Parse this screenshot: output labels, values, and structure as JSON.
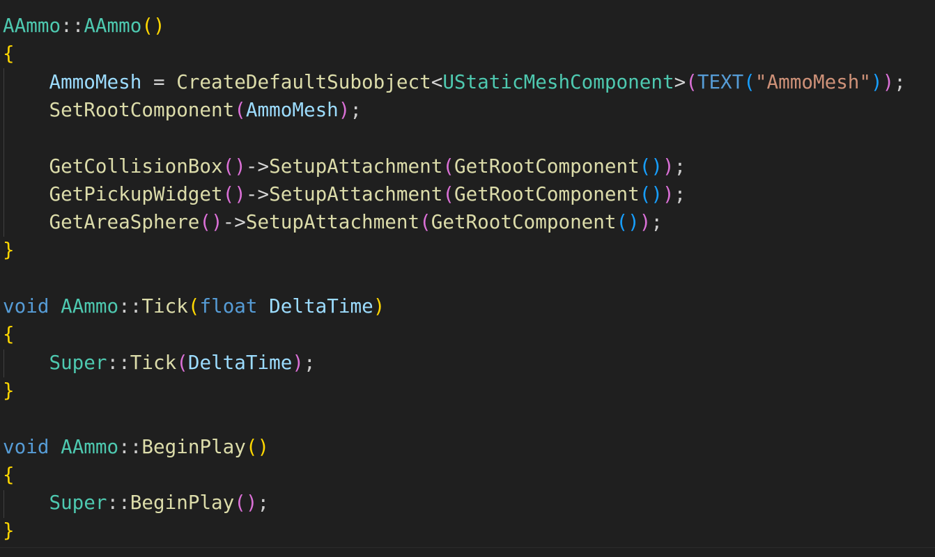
{
  "lines": [
    [
      [
        "type",
        "AAmmo"
      ],
      [
        "punct",
        "::"
      ],
      [
        "type",
        "AAmmo"
      ],
      [
        "b1",
        "()"
      ]
    ],
    [
      [
        "b1",
        "{"
      ]
    ],
    [
      [
        "ws",
        "    "
      ],
      [
        "var",
        "AmmoMesh"
      ],
      [
        "op",
        " = "
      ],
      [
        "fn",
        "CreateDefaultSubobject"
      ],
      [
        "op",
        "<"
      ],
      [
        "type",
        "UStaticMeshComponent"
      ],
      [
        "op",
        ">"
      ],
      [
        "b2",
        "("
      ],
      [
        "kw",
        "TEXT"
      ],
      [
        "b3",
        "("
      ],
      [
        "str",
        "\"AmmoMesh\""
      ],
      [
        "b3",
        ")"
      ],
      [
        "b2",
        ")"
      ],
      [
        "punct",
        ";"
      ]
    ],
    [
      [
        "ws",
        "    "
      ],
      [
        "fn",
        "SetRootComponent"
      ],
      [
        "b2",
        "("
      ],
      [
        "var",
        "AmmoMesh"
      ],
      [
        "b2",
        ")"
      ],
      [
        "punct",
        ";"
      ]
    ],
    [],
    [
      [
        "ws",
        "    "
      ],
      [
        "fn",
        "GetCollisionBox"
      ],
      [
        "b2",
        "()"
      ],
      [
        "op",
        "->"
      ],
      [
        "fn",
        "SetupAttachment"
      ],
      [
        "b2",
        "("
      ],
      [
        "fn",
        "GetRootComponent"
      ],
      [
        "b3",
        "()"
      ],
      [
        "b2",
        ")"
      ],
      [
        "punct",
        ";"
      ]
    ],
    [
      [
        "ws",
        "    "
      ],
      [
        "fn",
        "GetPickupWidget"
      ],
      [
        "b2",
        "()"
      ],
      [
        "op",
        "->"
      ],
      [
        "fn",
        "SetupAttachment"
      ],
      [
        "b2",
        "("
      ],
      [
        "fn",
        "GetRootComponent"
      ],
      [
        "b3",
        "()"
      ],
      [
        "b2",
        ")"
      ],
      [
        "punct",
        ";"
      ]
    ],
    [
      [
        "ws",
        "    "
      ],
      [
        "fn",
        "GetAreaSphere"
      ],
      [
        "b2",
        "()"
      ],
      [
        "op",
        "->"
      ],
      [
        "fn",
        "SetupAttachment"
      ],
      [
        "b2",
        "("
      ],
      [
        "fn",
        "GetRootComponent"
      ],
      [
        "b3",
        "()"
      ],
      [
        "b2",
        ")"
      ],
      [
        "punct",
        ";"
      ]
    ],
    [
      [
        "b1",
        "}"
      ]
    ],
    [],
    [
      [
        "kw",
        "void"
      ],
      [
        "op",
        " "
      ],
      [
        "type",
        "AAmmo"
      ],
      [
        "punct",
        "::"
      ],
      [
        "fn",
        "Tick"
      ],
      [
        "b1",
        "("
      ],
      [
        "kw",
        "float"
      ],
      [
        "op",
        " "
      ],
      [
        "var",
        "DeltaTime"
      ],
      [
        "b1",
        ")"
      ]
    ],
    [
      [
        "b1",
        "{"
      ]
    ],
    [
      [
        "ws",
        "    "
      ],
      [
        "type",
        "Super"
      ],
      [
        "punct",
        "::"
      ],
      [
        "fn",
        "Tick"
      ],
      [
        "b2",
        "("
      ],
      [
        "var",
        "DeltaTime"
      ],
      [
        "b2",
        ")"
      ],
      [
        "punct",
        ";"
      ]
    ],
    [
      [
        "b1",
        "}"
      ]
    ],
    [],
    [
      [
        "kw",
        "void"
      ],
      [
        "op",
        " "
      ],
      [
        "type",
        "AAmmo"
      ],
      [
        "punct",
        "::"
      ],
      [
        "fn",
        "BeginPlay"
      ],
      [
        "b1",
        "()"
      ]
    ],
    [
      [
        "b1",
        "{"
      ]
    ],
    [
      [
        "ws",
        "    "
      ],
      [
        "type",
        "Super"
      ],
      [
        "punct",
        "::"
      ],
      [
        "fn",
        "BeginPlay"
      ],
      [
        "b2",
        "()"
      ],
      [
        "punct",
        ";"
      ]
    ],
    [
      [
        "b1",
        "}"
      ]
    ]
  ],
  "token_styles": {
    "type": "#4ec9b0",
    "fn": "#dcdcaa",
    "var": "#9cdcfe",
    "kw": "#569cd6",
    "str": "#ce9178",
    "op": "#d4d4d4",
    "punct": "#cccccc",
    "b1": "#ffd700",
    "b2": "#da70d6",
    "b3": "#179fff"
  },
  "editor_background": "#1f1f1f"
}
